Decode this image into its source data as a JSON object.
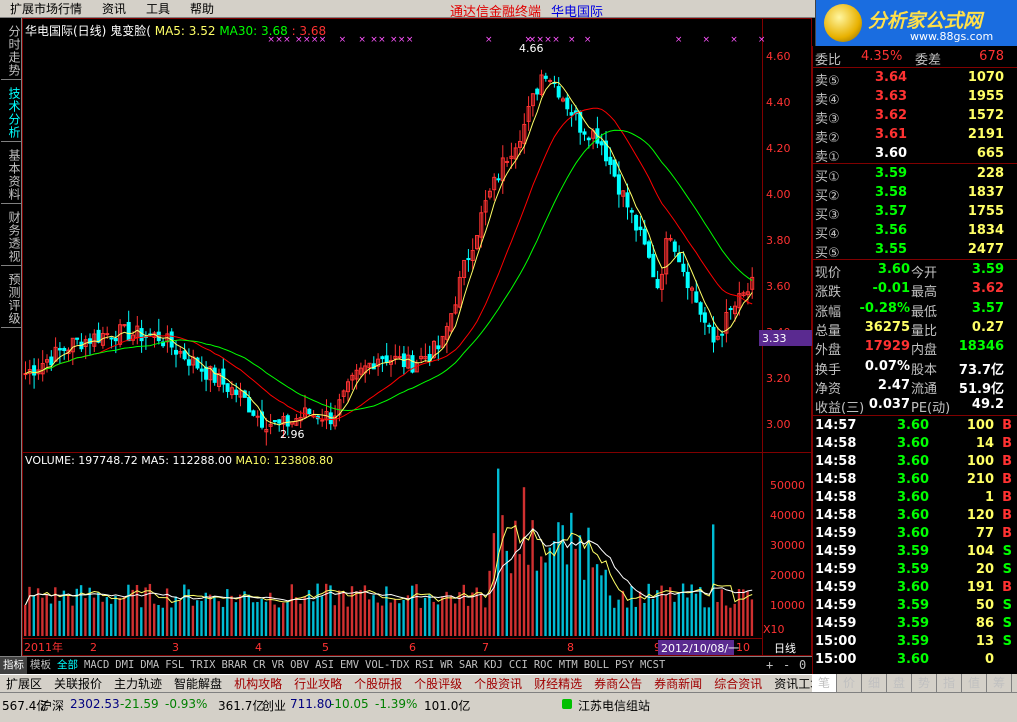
{
  "menu": {
    "items": [
      "扩展市场行情",
      "资讯",
      "工具",
      "帮助"
    ],
    "center_title": "通达信金融终端",
    "stock": "华电国际"
  },
  "logo": {
    "text": "分析家公式网",
    "url": "www.88gs.com"
  },
  "left_tabs": [
    {
      "label": "分时走势",
      "active": false
    },
    {
      "label": "技术分析",
      "active": true
    },
    {
      "label": "基本资料",
      "active": false
    },
    {
      "label": "财务透视",
      "active": false
    },
    {
      "label": "预测评级",
      "active": false
    }
  ],
  "price_title": {
    "name": "华电国际(日线)",
    "formula": "鬼变脸(",
    "ma5": "MA5: 3.52",
    "ma30": "MA30: 3.68",
    "x": ": 3.68"
  },
  "volume_title": {
    "volume": "VOLUME: 197748.72",
    "ma5": "MA5: 112288.00",
    "ma10": "MA10: 123808.80"
  },
  "price_axis": [
    "4.60",
    "4.40",
    "4.20",
    "4.00",
    "3.80",
    "3.60",
    "3.40",
    "3.20",
    "3.00"
  ],
  "volume_axis": [
    "50000",
    "40000",
    "30000",
    "20000",
    "10000",
    "X10"
  ],
  "annotations": {
    "high": "4.66",
    "low": "2.96",
    "cursor": "3.33"
  },
  "chart_data": {
    "type": "candlestick",
    "price_high": 4.66,
    "price_low": 2.96,
    "last": 3.6
  },
  "date_axis": {
    "labels": [
      "2011年",
      "2",
      "3",
      "4",
      "5",
      "6",
      "7",
      "8",
      "9",
      "10"
    ],
    "current": "2012/10/08/一",
    "period": "日线"
  },
  "orderbook": {
    "header": {
      "left": "委比",
      "left_val": "4.35%",
      "right": "委差",
      "right_val": "678"
    },
    "sell": [
      {
        "label": "卖⑤",
        "price": "3.64",
        "vol": "1070"
      },
      {
        "label": "卖④",
        "price": "3.63",
        "vol": "1955"
      },
      {
        "label": "卖③",
        "price": "3.62",
        "vol": "1572"
      },
      {
        "label": "卖②",
        "price": "3.61",
        "vol": "2191"
      },
      {
        "label": "卖①",
        "price": "3.60",
        "vol": "665"
      }
    ],
    "buy": [
      {
        "label": "买①",
        "price": "3.59",
        "vol": "228"
      },
      {
        "label": "买②",
        "price": "3.58",
        "vol": "1837"
      },
      {
        "label": "买③",
        "price": "3.57",
        "vol": "1755"
      },
      {
        "label": "买④",
        "price": "3.56",
        "vol": "1834"
      },
      {
        "label": "买⑤",
        "price": "3.55",
        "vol": "2477"
      }
    ]
  },
  "stats": [
    {
      "l1": "现价",
      "v1": "3.60",
      "l2": "今开",
      "v2": "3.59"
    },
    {
      "l1": "涨跌",
      "v1": "-0.01",
      "l2": "最高",
      "v2": "3.62"
    },
    {
      "l1": "涨幅",
      "v1": "-0.28%",
      "l2": "最低",
      "v2": "3.57"
    },
    {
      "l1": "总量",
      "v1": "36275",
      "l2": "量比",
      "v2": "0.27"
    },
    {
      "l1": "外盘",
      "v1": "17929",
      "l2": "内盘",
      "v2": "18346"
    },
    {
      "l1": "换手",
      "v1": "0.07%",
      "l2": "股本",
      "v2": "73.7亿"
    },
    {
      "l1": "净资",
      "v1": "2.47",
      "l2": "流通",
      "v2": "51.9亿"
    },
    {
      "l1": "收益(三)",
      "v1": "0.037",
      "l2": "PE(动)",
      "v2": "49.2"
    }
  ],
  "ticks": [
    {
      "t": "14:57",
      "p": "3.60",
      "v": "100",
      "d": "B"
    },
    {
      "t": "14:58",
      "p": "3.60",
      "v": "14",
      "d": "B"
    },
    {
      "t": "14:58",
      "p": "3.60",
      "v": "100",
      "d": "B"
    },
    {
      "t": "14:58",
      "p": "3.60",
      "v": "210",
      "d": "B"
    },
    {
      "t": "14:58",
      "p": "3.60",
      "v": "1",
      "d": "B"
    },
    {
      "t": "14:58",
      "p": "3.60",
      "v": "120",
      "d": "B"
    },
    {
      "t": "14:59",
      "p": "3.60",
      "v": "77",
      "d": "B"
    },
    {
      "t": "14:59",
      "p": "3.59",
      "v": "104",
      "d": "S"
    },
    {
      "t": "14:59",
      "p": "3.59",
      "v": "20",
      "d": "S"
    },
    {
      "t": "14:59",
      "p": "3.60",
      "v": "191",
      "d": "B"
    },
    {
      "t": "14:59",
      "p": "3.59",
      "v": "50",
      "d": "S"
    },
    {
      "t": "14:59",
      "p": "3.59",
      "v": "86",
      "d": "S"
    },
    {
      "t": "15:00",
      "p": "3.59",
      "v": "13",
      "d": "S"
    },
    {
      "t": "15:00",
      "p": "3.60",
      "v": "0",
      "d": ""
    }
  ],
  "indicator_tabs": [
    "指标",
    "模板",
    "全部",
    "MACD",
    "DMI",
    "DMA",
    "FSL",
    "TRIX",
    "BRAR",
    "CR",
    "VR",
    "OBV",
    "ASI",
    "EMV",
    "VOL-TDX",
    "RSI",
    "WR",
    "SAR",
    "KDJ",
    "CCI",
    "ROC",
    "MTM",
    "BOLL",
    "PSY",
    "MCST"
  ],
  "chart_controls": {
    "plus": "+",
    "minus": "-",
    "zero": "0"
  },
  "info_tabs": [
    "扩展区",
    "关联报价",
    "主力轨迹",
    "智能解盘",
    "机构攻略",
    "行业攻略",
    "个股研报",
    "个股评级",
    "个股资讯",
    "财经精选",
    "券商公告",
    "券商新闻",
    "综合资讯",
    "资讯工场"
  ],
  "right_tabs": [
    "笔",
    "价",
    "细",
    "盘",
    "势",
    "指",
    "值",
    "筹"
  ],
  "status": {
    "pre": "567.4亿",
    "market": "沪深",
    "idx1": "2302.53",
    "chg1": "-21.59",
    "pct1": "-0.93%",
    "amt1": "361.7亿",
    "board": "创业",
    "idx2": "711.80",
    "chg2": "-10.05",
    "pct2": "-1.39%",
    "amt2": "101.0亿",
    "site": "江苏电信组站"
  },
  "colors": {
    "up": "#ff3232",
    "down": "#00ffff",
    "ma5": "#ffff66",
    "ma30": "#ff0000",
    "ma_green": "#00ff00",
    "axis": "#800000"
  }
}
